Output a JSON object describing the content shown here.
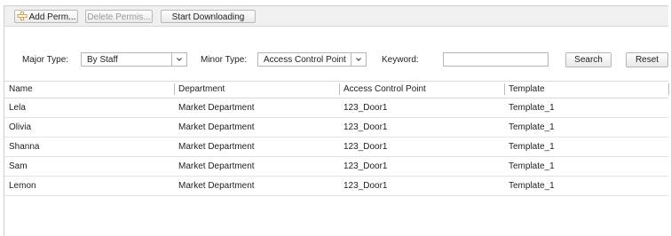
{
  "toolbar": {
    "add_label": "Add Perm...",
    "delete_label": "Delete Permis...",
    "download_label": "Start Downloading"
  },
  "filter": {
    "major_type_label": "Major Type:",
    "major_type_value": "By Staff",
    "minor_type_label": "Minor Type:",
    "minor_type_value": "Access Control Point",
    "keyword_label": "Keyword:",
    "keyword_value": "",
    "search_label": "Search",
    "reset_label": "Reset"
  },
  "table": {
    "columns": [
      "Name",
      "Department",
      "Access Control Point",
      "Template"
    ],
    "rows": [
      [
        "Lela",
        "Market Department",
        "123_Door1",
        "Template_1"
      ],
      [
        "Olivia",
        "Market Department",
        "123_Door1",
        "Template_1"
      ],
      [
        "Shanna",
        "Market Department",
        "123_Door1",
        "Template_1"
      ],
      [
        "Sam",
        "Market Department",
        "123_Door1",
        "Template_1"
      ],
      [
        "Lemon",
        "Market Department",
        "123_Door1",
        "Template_1"
      ]
    ]
  },
  "colors": {
    "toolbar_bg": "#f0f0f0",
    "border": "#d8d8d8",
    "add_icon": "#d9a54a"
  },
  "icons": {
    "add": "plus-icon",
    "dropdown": "chevron-down-icon"
  }
}
